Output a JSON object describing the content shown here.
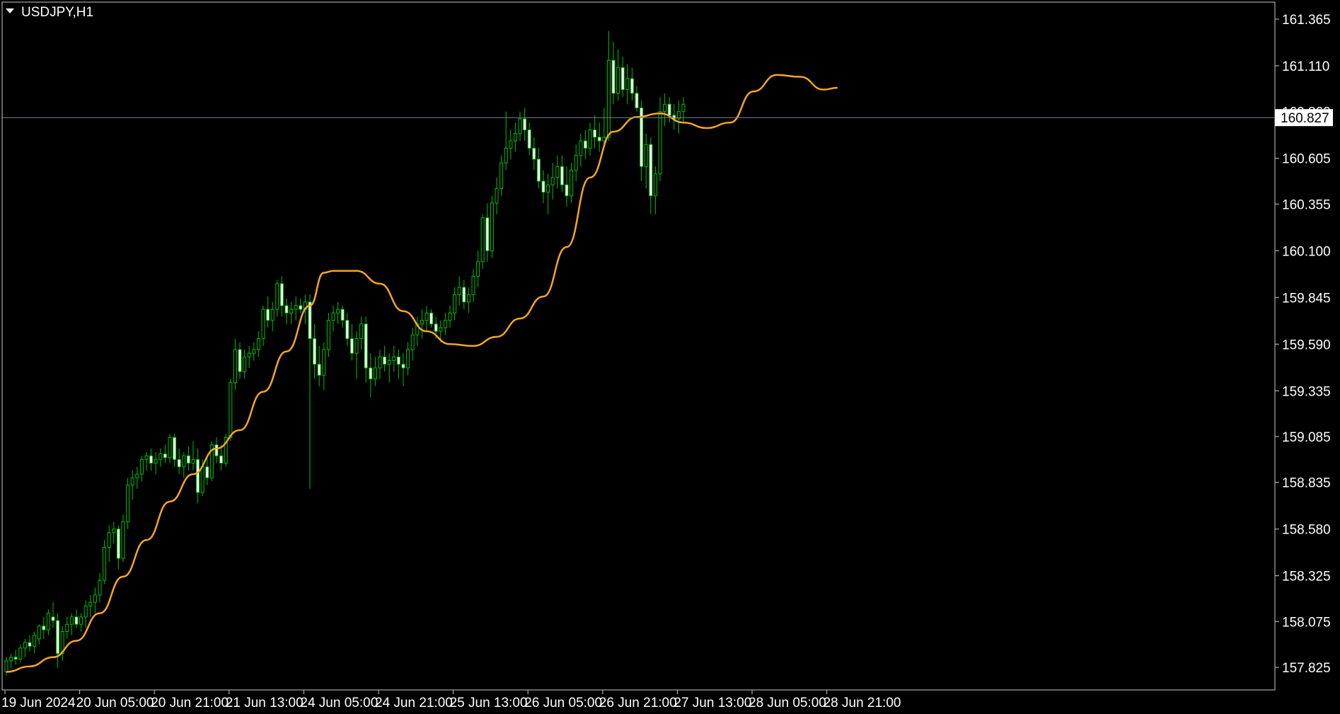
{
  "symbol_label": "USDJPY,H1",
  "colors": {
    "background": "#000000",
    "frame": "#c8c8c8",
    "text": "#ffffff",
    "candle": "#00c000",
    "bull_body_fill": "#000000",
    "bear_body_fill": "#ffffff",
    "ma_line": "#f5a623",
    "bid_line": "#778899",
    "price_label_bg": "#ffffff",
    "price_label_text": "#000000"
  },
  "current_price_label": "160.827",
  "chart_data": {
    "type": "candlestick",
    "symbol": "USDJPY",
    "timeframe": "H1",
    "ylim": [
      157.76,
      161.48
    ],
    "y_ticks": [
      "161.365",
      "161.110",
      "160.860",
      "160.605",
      "160.355",
      "160.100",
      "159.845",
      "159.590",
      "159.335",
      "159.085",
      "158.835",
      "158.580",
      "158.325",
      "158.075",
      "157.825"
    ],
    "x_ticks": [
      "19 Jun 2024",
      "20 Jun 05:00",
      "20 Jun 21:00",
      "21 Jun 13:00",
      "24 Jun 05:00",
      "24 Jun 21:00",
      "25 Jun 13:00",
      "26 Jun 05:00",
      "26 Jun 21:00",
      "27 Jun 13:00",
      "28 Jun 05:00",
      "28 Jun 21:00"
    ],
    "x_tick_bar_index": [
      0,
      16,
      32,
      48,
      64,
      80,
      96,
      112,
      128,
      144,
      160,
      176
    ],
    "bid_price": 160.827,
    "moving_average": {
      "anchors_bar_index": [
        0,
        5,
        10,
        15,
        20,
        25,
        30,
        35,
        40,
        45,
        50,
        55,
        60,
        65,
        68,
        70,
        75,
        80,
        85,
        90,
        95,
        100,
        105,
        110,
        115,
        120,
        125,
        130,
        135,
        140,
        145,
        150,
        155,
        160,
        165,
        170,
        175,
        178
      ],
      "anchors_value": [
        157.8,
        157.83,
        157.88,
        157.97,
        158.12,
        158.32,
        158.52,
        158.73,
        158.88,
        159.02,
        159.12,
        159.33,
        159.55,
        159.8,
        159.98,
        159.99,
        159.99,
        159.92,
        159.77,
        159.66,
        159.59,
        159.58,
        159.63,
        159.73,
        159.85,
        160.12,
        160.5,
        160.75,
        160.83,
        160.85,
        160.8,
        160.77,
        160.8,
        160.97,
        161.06,
        161.05,
        160.98,
        160.99
      ]
    },
    "candles": [
      [
        157.8,
        157.88,
        157.78,
        157.86
      ],
      [
        157.86,
        157.9,
        157.82,
        157.88
      ],
      [
        157.88,
        157.92,
        157.84,
        157.87
      ],
      [
        157.87,
        157.95,
        157.85,
        157.93
      ],
      [
        157.93,
        157.98,
        157.88,
        157.96
      ],
      [
        157.96,
        158.0,
        157.91,
        157.94
      ],
      [
        157.94,
        158.02,
        157.9,
        158.0
      ],
      [
        157.98,
        158.06,
        157.95,
        158.05
      ],
      [
        158.05,
        158.1,
        157.98,
        158.03
      ],
      [
        158.03,
        158.14,
        158.0,
        158.12
      ],
      [
        158.1,
        158.18,
        158.04,
        158.08
      ],
      [
        158.08,
        158.12,
        157.82,
        157.9
      ],
      [
        157.9,
        158.05,
        157.86,
        158.02
      ],
      [
        158.02,
        158.1,
        157.98,
        158.06
      ],
      [
        158.06,
        158.12,
        158.0,
        158.1
      ],
      [
        158.1,
        158.14,
        158.04,
        158.06
      ],
      [
        158.06,
        158.12,
        158.02,
        158.1
      ],
      [
        158.1,
        158.19,
        158.04,
        158.16
      ],
      [
        158.16,
        158.22,
        158.1,
        158.18
      ],
      [
        158.18,
        158.26,
        158.12,
        158.22
      ],
      [
        158.22,
        158.34,
        158.18,
        158.3
      ],
      [
        158.3,
        158.52,
        158.28,
        158.48
      ],
      [
        158.48,
        158.6,
        158.4,
        158.56
      ],
      [
        158.56,
        158.62,
        158.5,
        158.58
      ],
      [
        158.58,
        158.6,
        158.36,
        158.42
      ],
      [
        158.42,
        158.66,
        158.4,
        158.62
      ],
      [
        158.62,
        158.86,
        158.58,
        158.82
      ],
      [
        158.82,
        158.9,
        158.74,
        158.86
      ],
      [
        158.86,
        158.92,
        158.8,
        158.88
      ],
      [
        158.88,
        158.98,
        158.84,
        158.96
      ],
      [
        158.96,
        159.0,
        158.9,
        158.98
      ],
      [
        158.98,
        159.02,
        158.9,
        158.94
      ],
      [
        158.94,
        159.0,
        158.88,
        158.96
      ],
      [
        158.96,
        159.02,
        158.92,
        158.99
      ],
      [
        158.99,
        159.04,
        158.94,
        158.97
      ],
      [
        158.97,
        159.1,
        158.94,
        159.08
      ],
      [
        159.08,
        159.1,
        158.92,
        158.96
      ],
      [
        158.96,
        159.02,
        158.88,
        158.92
      ],
      [
        158.92,
        159.0,
        158.86,
        158.98
      ],
      [
        158.98,
        159.03,
        158.9,
        158.94
      ],
      [
        158.94,
        159.06,
        158.9,
        158.96
      ],
      [
        158.96,
        159.02,
        158.72,
        158.78
      ],
      [
        158.78,
        158.96,
        158.76,
        158.92
      ],
      [
        158.92,
        158.98,
        158.82,
        158.86
      ],
      [
        158.86,
        159.06,
        158.84,
        159.04
      ],
      [
        159.04,
        159.08,
        158.94,
        158.98
      ],
      [
        158.98,
        159.04,
        158.9,
        158.94
      ],
      [
        158.94,
        159.1,
        158.92,
        159.08
      ],
      [
        159.08,
        159.4,
        159.06,
        159.38
      ],
      [
        159.38,
        159.62,
        159.34,
        159.56
      ],
      [
        159.56,
        159.6,
        159.4,
        159.44
      ],
      [
        159.44,
        159.56,
        159.4,
        159.52
      ],
      [
        159.52,
        159.58,
        159.46,
        159.54
      ],
      [
        159.54,
        159.6,
        159.5,
        159.56
      ],
      [
        159.56,
        159.66,
        159.52,
        159.62
      ],
      [
        159.62,
        159.8,
        159.58,
        159.78
      ],
      [
        159.78,
        159.85,
        159.68,
        159.72
      ],
      [
        159.72,
        159.82,
        159.66,
        159.78
      ],
      [
        159.78,
        159.94,
        159.74,
        159.92
      ],
      [
        159.92,
        159.96,
        159.74,
        159.8
      ],
      [
        159.8,
        159.84,
        159.7,
        159.76
      ],
      [
        159.76,
        159.82,
        159.7,
        159.78
      ],
      [
        159.78,
        159.85,
        159.72,
        159.8
      ],
      [
        159.8,
        159.84,
        159.76,
        159.78
      ],
      [
        159.78,
        159.86,
        159.7,
        159.82
      ],
      [
        159.82,
        159.86,
        158.8,
        159.62
      ],
      [
        159.62,
        159.7,
        159.4,
        159.48
      ],
      [
        159.48,
        159.58,
        159.36,
        159.42
      ],
      [
        159.42,
        159.6,
        159.34,
        159.56
      ],
      [
        159.56,
        159.76,
        159.52,
        159.72
      ],
      [
        159.72,
        159.8,
        159.66,
        159.76
      ],
      [
        159.76,
        159.82,
        159.7,
        159.78
      ],
      [
        159.78,
        159.8,
        159.68,
        159.72
      ],
      [
        159.72,
        159.76,
        159.58,
        159.62
      ],
      [
        159.62,
        159.7,
        159.5,
        159.54
      ],
      [
        159.54,
        159.66,
        159.4,
        159.62
      ],
      [
        159.62,
        159.74,
        159.56,
        159.7
      ],
      [
        159.7,
        159.74,
        159.38,
        159.46
      ],
      [
        159.46,
        159.54,
        159.3,
        159.4
      ],
      [
        159.4,
        159.52,
        159.36,
        159.46
      ],
      [
        159.46,
        159.56,
        159.4,
        159.52
      ],
      [
        159.52,
        159.58,
        159.44,
        159.48
      ],
      [
        159.48,
        159.54,
        159.38,
        159.5
      ],
      [
        159.5,
        159.58,
        159.44,
        159.52
      ],
      [
        159.52,
        159.56,
        159.4,
        159.48
      ],
      [
        159.48,
        159.54,
        159.36,
        159.46
      ],
      [
        159.46,
        159.6,
        159.42,
        159.56
      ],
      [
        159.56,
        159.68,
        159.5,
        159.64
      ],
      [
        159.64,
        159.74,
        159.58,
        159.7
      ],
      [
        159.7,
        159.78,
        159.62,
        159.72
      ],
      [
        159.72,
        159.8,
        159.66,
        159.76
      ],
      [
        159.76,
        159.78,
        159.68,
        159.7
      ],
      [
        159.7,
        159.74,
        159.62,
        159.66
      ],
      [
        159.66,
        159.72,
        159.6,
        159.68
      ],
      [
        159.68,
        159.76,
        159.64,
        159.72
      ],
      [
        159.72,
        159.8,
        159.68,
        159.76
      ],
      [
        159.76,
        159.9,
        159.72,
        159.86
      ],
      [
        159.86,
        159.96,
        159.8,
        159.9
      ],
      [
        159.9,
        159.94,
        159.78,
        159.82
      ],
      [
        159.82,
        159.9,
        159.76,
        159.86
      ],
      [
        159.86,
        160.0,
        159.82,
        159.96
      ],
      [
        159.96,
        160.1,
        159.9,
        160.04
      ],
      [
        160.04,
        160.3,
        160.0,
        160.28
      ],
      [
        160.28,
        160.36,
        160.04,
        160.1
      ],
      [
        160.1,
        160.4,
        160.06,
        160.36
      ],
      [
        160.36,
        160.5,
        160.3,
        160.44
      ],
      [
        160.44,
        160.62,
        160.4,
        160.58
      ],
      [
        160.58,
        160.86,
        160.54,
        160.66
      ],
      [
        160.66,
        160.76,
        160.6,
        160.7
      ],
      [
        160.7,
        160.8,
        160.64,
        160.74
      ],
      [
        160.74,
        160.86,
        160.7,
        160.82
      ],
      [
        160.82,
        160.88,
        160.7,
        160.76
      ],
      [
        160.76,
        160.8,
        160.62,
        160.66
      ],
      [
        160.66,
        160.72,
        160.54,
        160.6
      ],
      [
        160.6,
        160.66,
        160.44,
        160.48
      ],
      [
        160.48,
        160.54,
        160.36,
        160.42
      ],
      [
        160.42,
        160.52,
        160.3,
        160.46
      ],
      [
        160.46,
        160.58,
        160.38,
        160.5
      ],
      [
        160.5,
        160.62,
        160.44,
        160.56
      ],
      [
        160.56,
        160.62,
        160.42,
        160.46
      ],
      [
        160.46,
        160.56,
        160.34,
        160.4
      ],
      [
        160.4,
        160.58,
        160.36,
        160.54
      ],
      [
        160.54,
        160.68,
        160.48,
        160.62
      ],
      [
        160.62,
        160.74,
        160.56,
        160.7
      ],
      [
        160.7,
        160.76,
        160.6,
        160.66
      ],
      [
        160.66,
        160.8,
        160.62,
        160.76
      ],
      [
        160.76,
        160.84,
        160.66,
        160.72
      ],
      [
        160.72,
        160.8,
        160.64,
        160.7
      ],
      [
        160.7,
        160.88,
        160.66,
        160.72
      ],
      [
        160.72,
        161.3,
        160.7,
        161.14
      ],
      [
        161.14,
        161.24,
        160.9,
        160.96
      ],
      [
        160.96,
        161.2,
        160.92,
        161.1
      ],
      [
        161.1,
        161.16,
        160.94,
        160.98
      ],
      [
        160.98,
        161.12,
        160.9,
        161.04
      ],
      [
        161.04,
        161.1,
        160.92,
        160.96
      ],
      [
        160.96,
        161.0,
        160.86,
        160.88
      ],
      [
        160.88,
        160.92,
        160.48,
        160.56
      ],
      [
        160.56,
        160.74,
        160.44,
        160.68
      ],
      [
        160.68,
        160.72,
        160.3,
        160.4
      ],
      [
        160.4,
        160.56,
        160.3,
        160.52
      ],
      [
        160.52,
        160.94,
        160.48,
        160.86
      ],
      [
        160.86,
        160.96,
        160.78,
        160.9
      ],
      [
        160.9,
        160.94,
        160.8,
        160.84
      ],
      [
        160.84,
        160.9,
        160.76,
        160.82
      ],
      [
        160.82,
        160.92,
        160.74,
        160.86
      ],
      [
        160.86,
        160.94,
        160.8,
        160.9
      ]
    ]
  }
}
